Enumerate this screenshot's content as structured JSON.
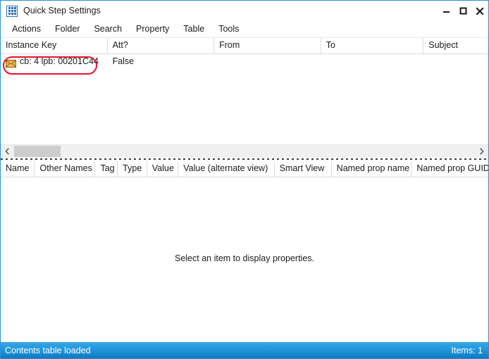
{
  "window": {
    "title": "Quick Step Settings",
    "icon": "grid-dots-icon",
    "border_color": "#2b8fd6",
    "controls": {
      "minimize": "minimize-icon",
      "maximize": "maximize-icon",
      "close": "close-icon"
    }
  },
  "menu": {
    "items": [
      {
        "label": "Actions"
      },
      {
        "label": "Folder"
      },
      {
        "label": "Search"
      },
      {
        "label": "Property"
      },
      {
        "label": "Table"
      },
      {
        "label": "Tools"
      }
    ]
  },
  "contents_table": {
    "columns": [
      {
        "label": "Instance Key",
        "width": 152
      },
      {
        "label": "Att?",
        "width": 152
      },
      {
        "label": "From",
        "width": 152
      },
      {
        "label": "To",
        "width": 146
      },
      {
        "label": "Subject",
        "width": 92
      }
    ],
    "rows": [
      {
        "icon": "envelope-icon",
        "instance_key": "cb: 4 lpb: 00201C44",
        "att": "False",
        "from": "",
        "to": "",
        "subject": "",
        "highlighted": true,
        "highlight_color": "#e8112d"
      }
    ],
    "scrollbar": {
      "left_arrow": "chevron-left-icon",
      "right_arrow": "chevron-right-icon"
    }
  },
  "property_table": {
    "columns": [
      {
        "label": "Name",
        "width": 49
      },
      {
        "label": "Other Names",
        "width": 87
      },
      {
        "label": "Tag",
        "width": 32
      },
      {
        "label": "Type",
        "width": 42
      },
      {
        "label": "Value",
        "width": 45
      },
      {
        "label": "Value (alternate view)",
        "width": 138
      },
      {
        "label": "Smart View",
        "width": 82
      },
      {
        "label": "Named prop name",
        "width": 115
      },
      {
        "label": "Named prop GUID",
        "width": 110
      }
    ],
    "empty_message": "Select an item to display properties."
  },
  "statusbar": {
    "left_text": "Contents table loaded",
    "right_text": "Items: 1",
    "accent_color": "#2197dd"
  }
}
